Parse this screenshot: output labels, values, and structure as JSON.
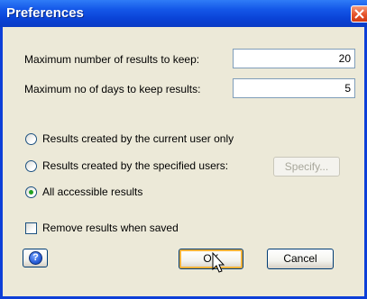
{
  "window": {
    "title": "Preferences"
  },
  "fields": {
    "max_results_label": "Maximum number of results to keep:",
    "max_results_value": "20",
    "max_days_label": "Maximum no of days to keep results:",
    "max_days_value": "5"
  },
  "scope_options": [
    {
      "label": "Results created by the current user only",
      "selected": false
    },
    {
      "label": "Results created by the specified users:",
      "selected": false
    },
    {
      "label": "All accessible results",
      "selected": true
    }
  ],
  "specify_button": {
    "label": "Specify...",
    "enabled": false
  },
  "remove_checkbox": {
    "label": "Remove results when saved",
    "checked": false
  },
  "buttons": {
    "ok": "OK",
    "cancel": "Cancel"
  },
  "icons": {
    "close": "close-icon",
    "help": "help-icon",
    "cursor": "mouse-pointer-icon"
  },
  "colors": {
    "titlebar": "#0a42d6",
    "dialog_bg": "#ece9d8",
    "close": "#e5532a",
    "radio_selected": "#21a121",
    "default_button_highlight": "#f8b33a"
  }
}
